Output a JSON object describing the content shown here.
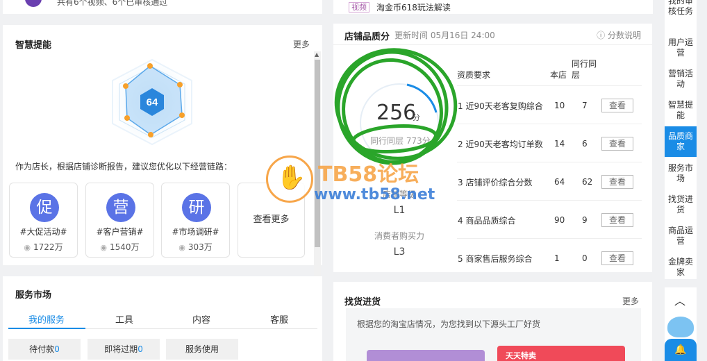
{
  "top": {
    "left_text": "共有6个视频、6个已审核通过",
    "video_tag": "视频",
    "video_title": "淘金币618玩法解读"
  },
  "smart": {
    "title": "智慧提能",
    "more": "更多",
    "score": "64",
    "advice": "作为店长，根据店铺诊断报告，建议您优化以下经营链路：",
    "cards": [
      {
        "char": "促",
        "tag": "#大促活动#",
        "views": "1722万"
      },
      {
        "char": "营",
        "tag": "#客户营销#",
        "views": "1540万"
      },
      {
        "char": "研",
        "tag": "#市场调研#",
        "views": "303万"
      }
    ],
    "see_more": "查看更多"
  },
  "quality": {
    "title": "店铺品质分",
    "update_time": "更新时间 05月16日 24:00",
    "explain": "分数说明",
    "score": "256",
    "score_unit": "分",
    "peer_score": "同行同层 773分",
    "level1_label": "店铺等级",
    "level1_value": "L1",
    "level2_label": "消费者购买力",
    "level2_value": "L3",
    "headers": {
      "req": "资质要求",
      "mine": "本店",
      "peer": "同行同层"
    },
    "rows": [
      {
        "name": "1 近90天老客复购综合",
        "mine": "10",
        "peer": "7",
        "action": "查看"
      },
      {
        "name": "2 近90天老客均订单数",
        "mine": "14",
        "peer": "6",
        "action": "查看"
      },
      {
        "name": "3 店铺评价综合分数",
        "mine": "64",
        "peer": "62",
        "action": "查看"
      },
      {
        "name": "4 商品品质综合",
        "mine": "90",
        "peer": "9",
        "action": "查看"
      },
      {
        "name": "5 商家售后服务综合",
        "mine": "1",
        "peer": "0",
        "action": "查看"
      }
    ]
  },
  "service": {
    "title": "服务市场",
    "tabs": [
      "我的服务",
      "工具",
      "内容",
      "客服"
    ],
    "buttons": [
      {
        "label": "待付款",
        "count": "0"
      },
      {
        "label": "即将过期",
        "count": "0"
      },
      {
        "label": "服务使用",
        "count": ""
      }
    ]
  },
  "sourcing": {
    "title": "找货进货",
    "more": "更多",
    "desc": "根据您的淘宝店情况，为您找到以下源头工厂好货",
    "promo_text": "天天特卖"
  },
  "sidebar": {
    "items": [
      "我的审核任务",
      "用户运营",
      "营销活动",
      "智慧提能",
      "品质商家",
      "服务市场",
      "找货进货",
      "商品运营",
      "金牌卖家"
    ],
    "active": "品质商家"
  },
  "watermark": {
    "line1": "TB58论坛",
    "line2": "www.tb58.net"
  },
  "colors": {
    "accent": "#1a8ce6",
    "card_circle": "#5a73e6",
    "annotation_green": "#2aa52a",
    "watermark_orange": "#f7a64a"
  }
}
